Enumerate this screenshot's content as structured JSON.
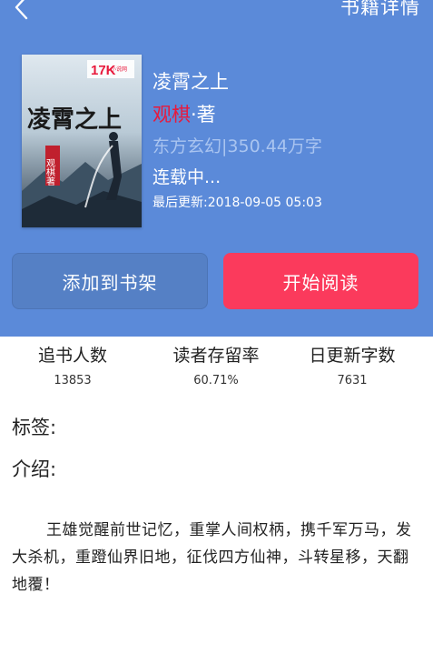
{
  "header": {
    "title": "书籍详情",
    "background_color": "#5b8ad9",
    "back_icon": "chevron-left-icon"
  },
  "book": {
    "cover_brand": "17K",
    "cover_brand_sub": "小说网",
    "cover_title": "凌霄之上",
    "cover_author_seal": "观棋著",
    "title": "凌霄之上",
    "author": "观棋",
    "author_suffix": "·著",
    "author_color": "#e8193c",
    "genre_words": "东方玄幻|350.44万字",
    "status": "连载中...",
    "last_updated": "最后更新:2018-09-05 05:03"
  },
  "actions": {
    "add_to_shelf": "添加到书架",
    "start_reading": "开始阅读",
    "start_reading_color": "#fb3a5c"
  },
  "stats": [
    {
      "label": "追书人数",
      "value": "13853"
    },
    {
      "label": "读者存留率",
      "value": "60.71%"
    },
    {
      "label": "日更新字数",
      "value": "7631"
    }
  ],
  "meta": {
    "tags_label": "标签:",
    "intro_label": "介绍:"
  },
  "intro": "王雄觉醒前世记忆，重掌人间权柄，携千军万马，发大杀机，重蹬仙界旧地，征伐四方仙神，斗转星移，天翻地覆！"
}
